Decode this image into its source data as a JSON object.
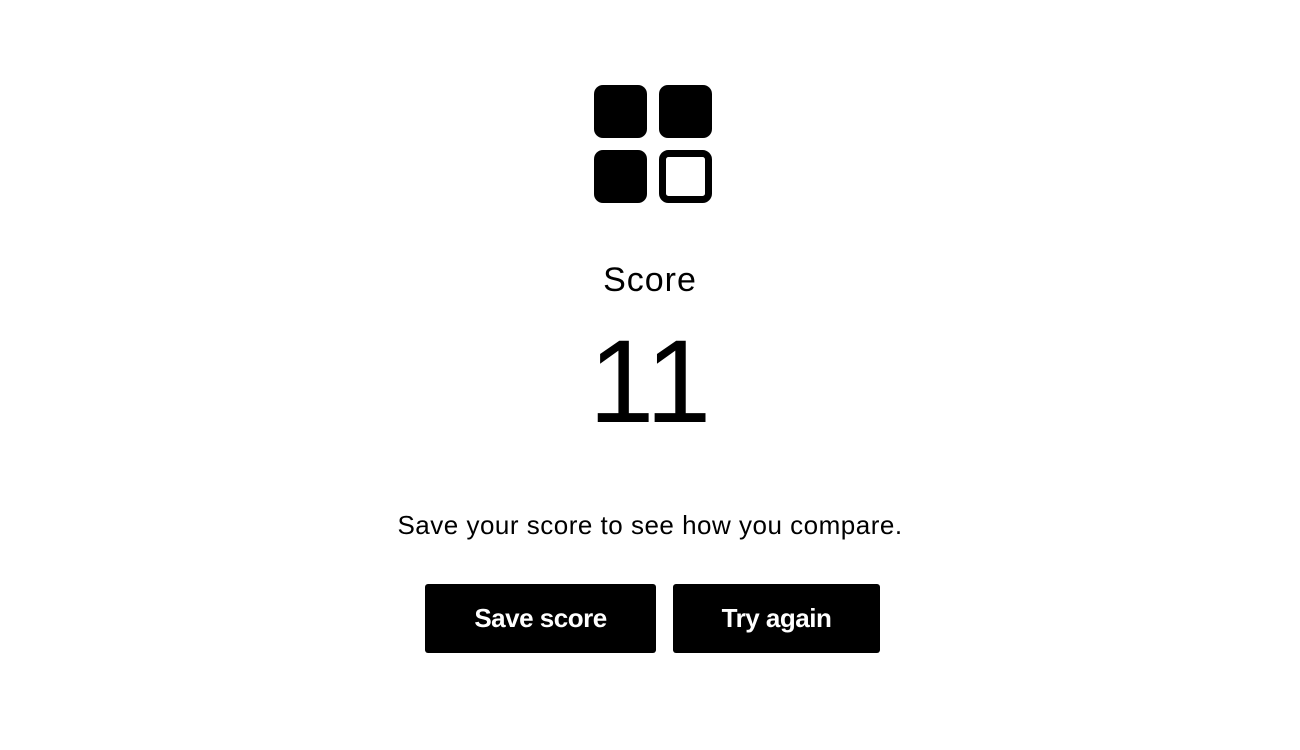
{
  "logo": {
    "icon": "four-squares-grid-icon"
  },
  "score": {
    "label": "Score",
    "value": "11"
  },
  "prompt": "Save your score to see how you compare.",
  "actions": {
    "save_label": "Save score",
    "retry_label": "Try again"
  },
  "colors": {
    "background": "#ffffff",
    "foreground": "#000000",
    "button_text": "#ffffff"
  }
}
